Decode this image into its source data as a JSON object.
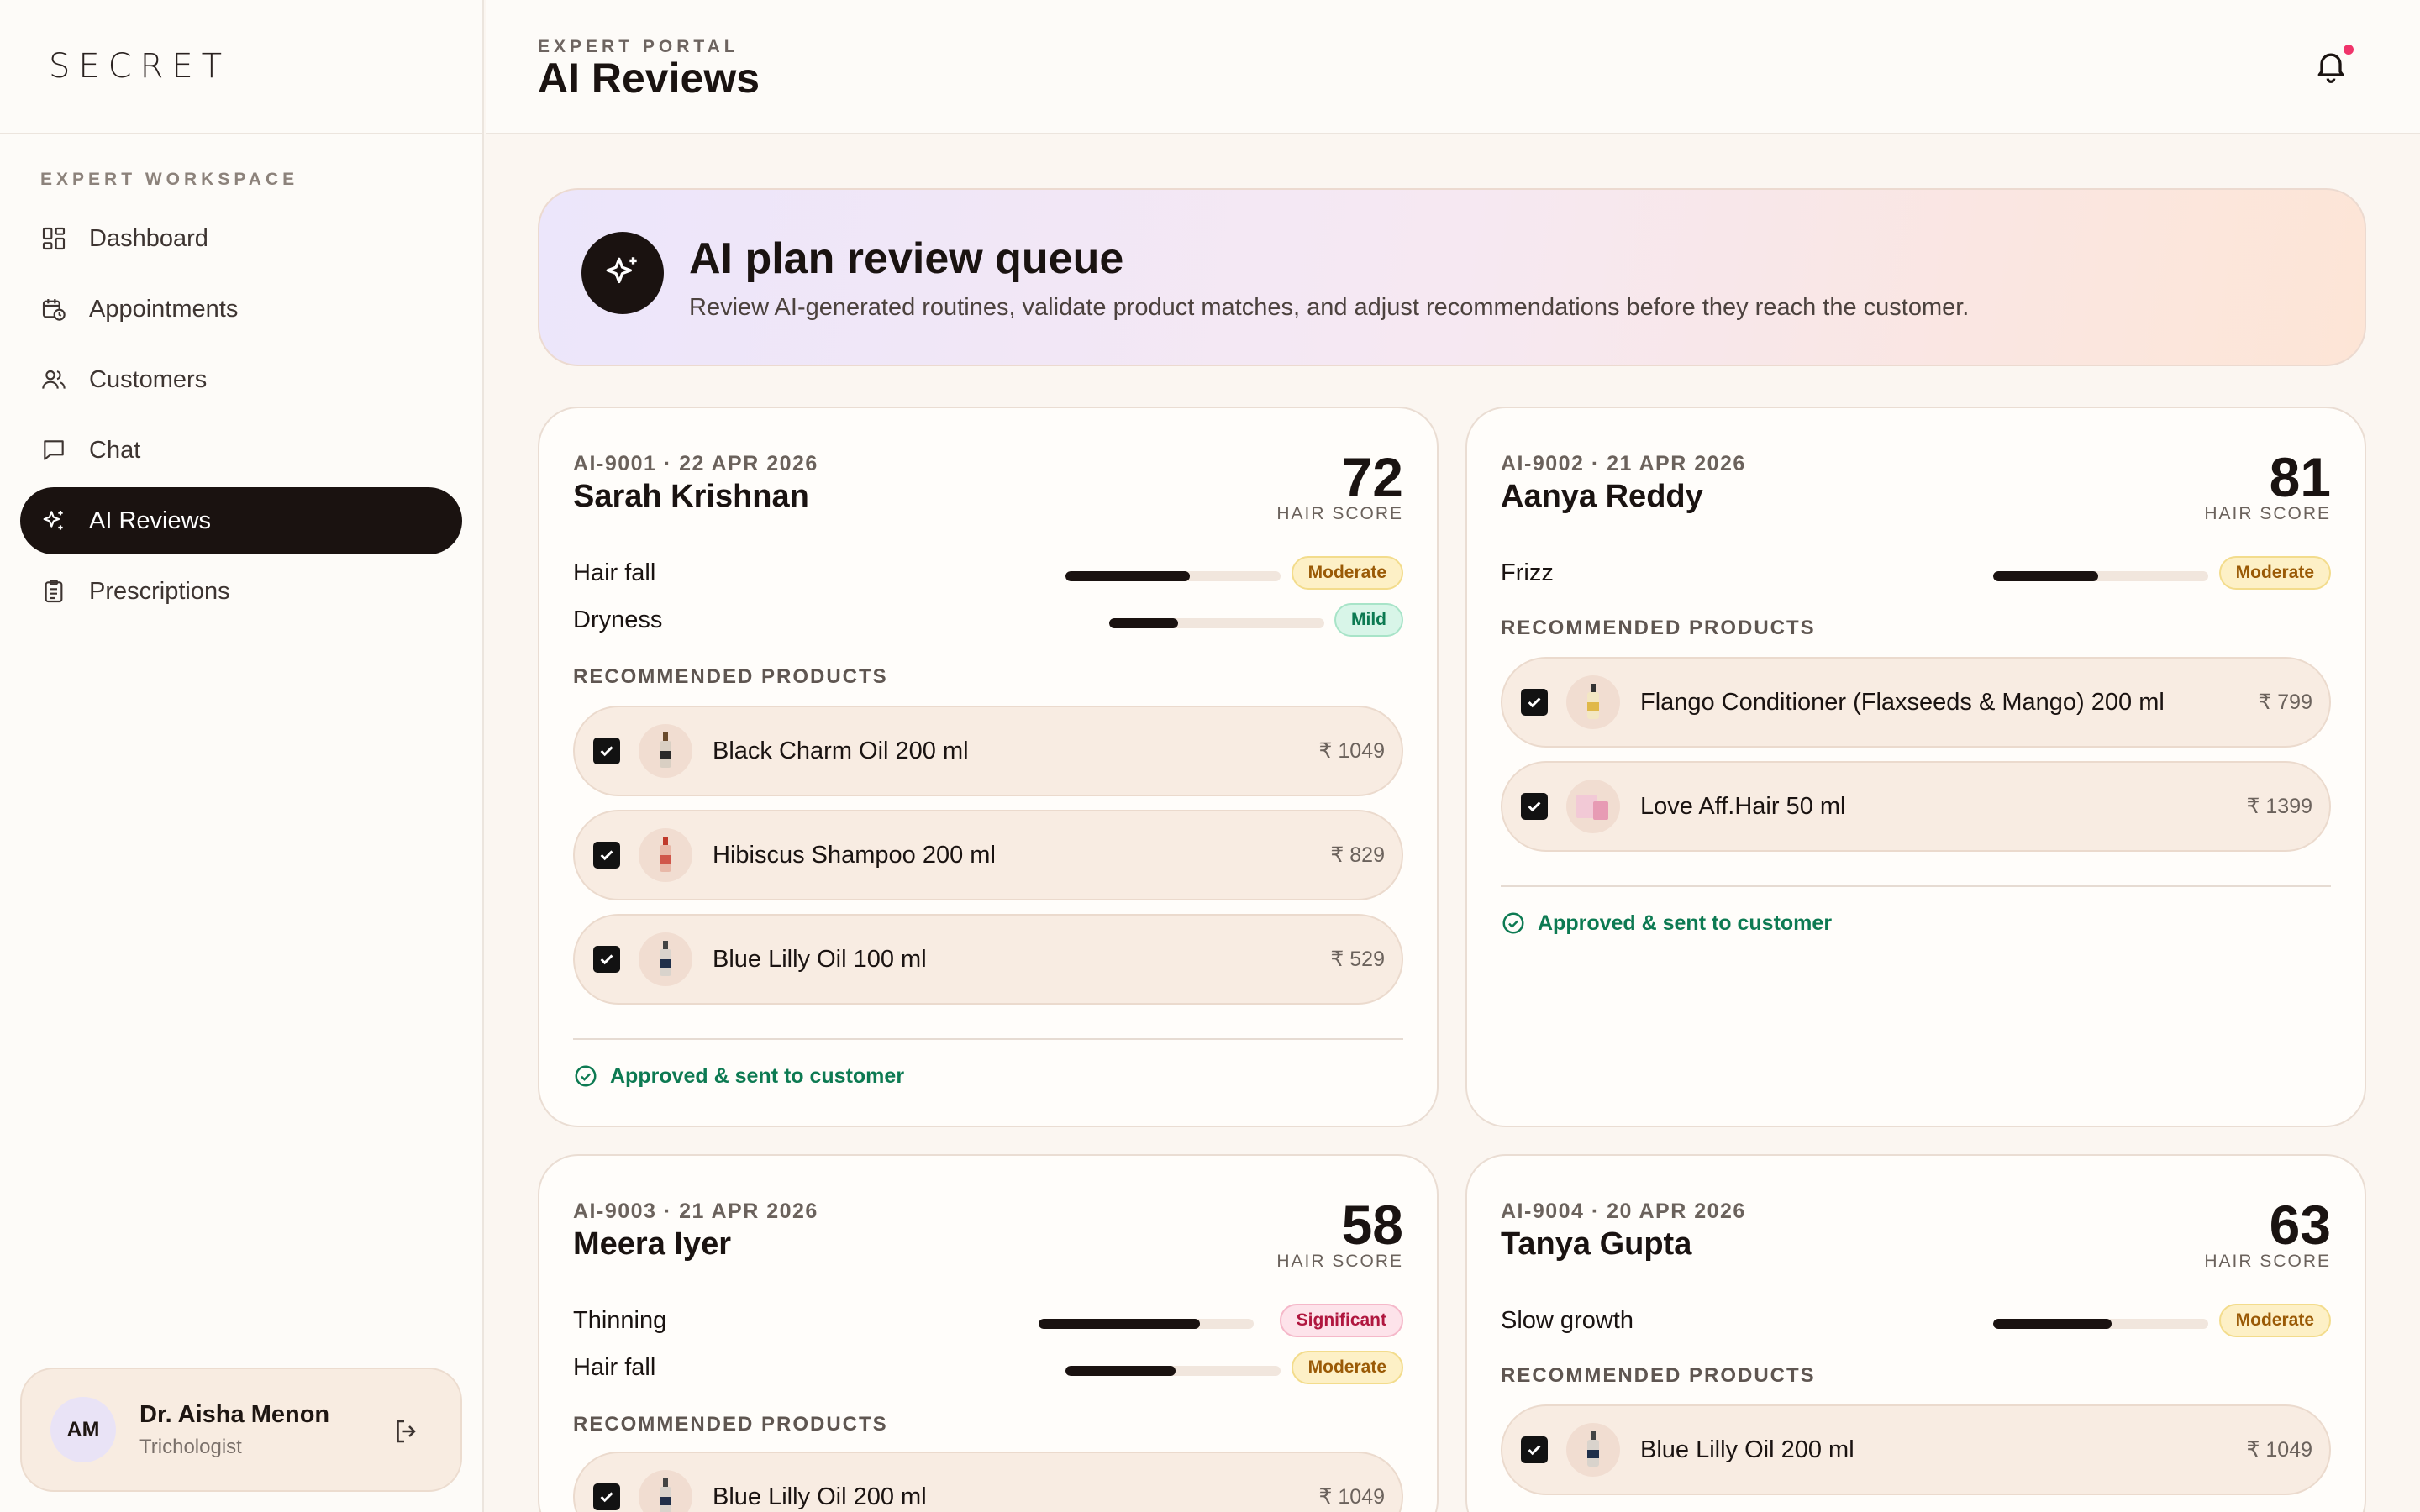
{
  "sidebar": {
    "brand": "SECRET",
    "section_label": "EXPERT WORKSPACE",
    "items": [
      {
        "label": "Dashboard"
      },
      {
        "label": "Appointments"
      },
      {
        "label": "Customers"
      },
      {
        "label": "Chat"
      },
      {
        "label": "AI Reviews"
      },
      {
        "label": "Prescriptions"
      }
    ],
    "profile": {
      "initials": "AM",
      "name": "Dr. Aisha Menon",
      "role": "Trichologist"
    }
  },
  "header": {
    "eyebrow": "EXPERT PORTAL",
    "title": "AI Reviews"
  },
  "hero": {
    "title": "AI plan review queue",
    "subtitle": "Review AI-generated routines, validate product matches, and adjust recommendations before they reach the customer."
  },
  "labels": {
    "hair_score": "HAIR SCORE",
    "recommended": "RECOMMENDED PRODUCTS"
  },
  "colors": {
    "accent_dark": "#1a1210",
    "approved_green": "#0d7a52",
    "notification_dot": "#f0346b"
  },
  "cards": [
    {
      "id": "AI-9001 · 22 APR 2026",
      "name": "Sarah Krishnan",
      "score": "72",
      "concerns": [
        {
          "name": "Hair fall",
          "severity": "Moderate",
          "level": 0.58
        },
        {
          "name": "Dryness",
          "severity": "Mild",
          "level": 0.32
        }
      ],
      "products": [
        {
          "name": "Black Charm Oil 200 ml",
          "price": "₹ 1049"
        },
        {
          "name": "Hibiscus Shampoo 200 ml",
          "price": "₹ 829"
        },
        {
          "name": "Blue Lilly Oil 100 ml",
          "price": "₹ 529"
        }
      ],
      "status": "Approved & sent to customer"
    },
    {
      "id": "AI-9002 · 21 APR 2026",
      "name": "Aanya Reddy",
      "score": "81",
      "concerns": [
        {
          "name": "Frizz",
          "severity": "Moderate",
          "level": 0.49
        }
      ],
      "products": [
        {
          "name": "Flango Conditioner (Flaxseeds & Mango) 200 ml",
          "price": "₹ 799"
        },
        {
          "name": "Love Aff.Hair 50 ml",
          "price": "₹ 1399"
        }
      ],
      "status": "Approved & sent to customer"
    },
    {
      "id": "AI-9003 · 21 APR 2026",
      "name": "Meera Iyer",
      "score": "58",
      "concerns": [
        {
          "name": "Thinning",
          "severity": "Significant",
          "level": 0.75
        },
        {
          "name": "Hair fall",
          "severity": "Moderate",
          "level": 0.51
        }
      ],
      "products": [
        {
          "name": "Blue Lilly Oil 200 ml",
          "price": "₹ 1049"
        }
      ]
    },
    {
      "id": "AI-9004 · 20 APR 2026",
      "name": "Tanya Gupta",
      "score": "63",
      "concerns": [
        {
          "name": "Slow growth",
          "severity": "Moderate",
          "level": 0.55
        }
      ],
      "products": [
        {
          "name": "Blue Lilly Oil 200 ml",
          "price": "₹ 1049"
        }
      ]
    }
  ]
}
